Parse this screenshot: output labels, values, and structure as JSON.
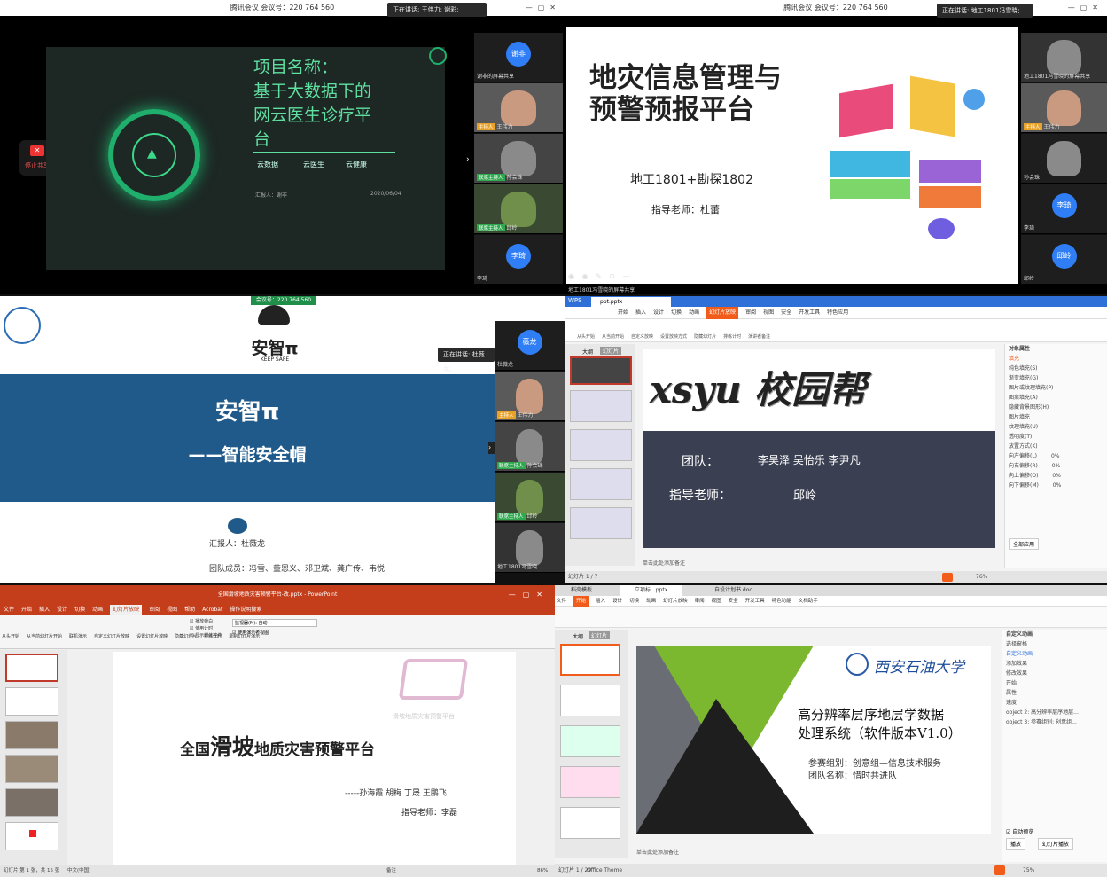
{
  "tile1": {
    "window_title": "腾讯会议 会议号：220 764 560",
    "speaking": "正在讲话: 王伟力; 谢彩;",
    "stop_share": "停止共享",
    "slide": {
      "title_lines": [
        "项目名称：",
        "基于大数据下的",
        "网云医生诊疗平",
        "台"
      ],
      "keywords": [
        "云数据",
        "云医生",
        "云健康"
      ],
      "reporter": "汇报人：谢非",
      "date": "2020/06/04"
    },
    "participants": [
      {
        "name": "谢非的屏幕共享",
        "avatar": "谢非"
      },
      {
        "name": "王伟力",
        "tag": "主持人"
      },
      {
        "name": "孙会珠",
        "tag": "联席主持人"
      },
      {
        "name": "邱岭",
        "tag": "联席主持人"
      },
      {
        "name": "李琦",
        "avatar": "李琦"
      }
    ]
  },
  "tile2": {
    "window_title": "腾讯会议 会议号：220 764 560",
    "speaking": "正在讲话: 地工1801冯雪晓;",
    "slide": {
      "title_lines": [
        "地灾信息管理与",
        "预警预报平台"
      ],
      "classes": "地工1801+勘探1802",
      "advisor": "指导老师：杜蕾"
    },
    "bottom_text": "地工1801冯雪晓的屏幕共享",
    "participants": [
      {
        "name": "地工1801冯雪晓的屏幕共享"
      },
      {
        "name": "王伟力",
        "tag": "主持人"
      },
      {
        "name": "孙会珠"
      },
      {
        "name": "李琦",
        "avatar": "李琦"
      },
      {
        "name": "邱岭",
        "avatar": "邱岭"
      }
    ]
  },
  "tile3": {
    "meeting_no": "会议号：220 764 560",
    "speaking": "正在讲话: 杜薇龙;",
    "slide": {
      "logo_title": "安智π",
      "logo_sub": "KEEP SAFE",
      "title": "安智π",
      "subtitle": "——智能安全帽",
      "reporter": "汇报人：杜薇龙",
      "members": "团队成员：冯雪、董恩义、邓卫斌、龚广传、韦悦"
    },
    "participants": [
      {
        "name": "杜薇龙",
        "avatar": "薇龙"
      },
      {
        "name": "王伟力",
        "tag": "主持人"
      },
      {
        "name": "孙会珠",
        "tag": "联席主持人"
      },
      {
        "name": "邱岭",
        "tag": "联席主持人"
      },
      {
        "name": "地工1801冯雪晓"
      }
    ]
  },
  "tile4": {
    "app": "WPS",
    "doc_tab": "ppt.pptx",
    "menu": [
      "开始",
      "插入",
      "设计",
      "切换",
      "动画",
      "幻灯片放映",
      "审阅",
      "视图",
      "安全",
      "开发工具",
      "特色应用"
    ],
    "active_menu": "幻灯片放映",
    "toolbar": [
      "从头开始",
      "从当前开始",
      "自定义放映",
      "设置放映方式",
      "隐藏幻灯片",
      "排练计时",
      "演讲者备注"
    ],
    "panel_tabs": [
      "大纲",
      "幻灯片"
    ],
    "slide": {
      "title": "xsyu 校园帮",
      "team_label": "团队：",
      "team": "李昊泽 吴怡乐 李尹凡",
      "advisor_label": "指导老师：",
      "advisor": "邱岭"
    },
    "notes": "单击此处添加备注",
    "status": "幻灯片 1 / 7",
    "zoom": "76%",
    "right_panel_title": "对象属性",
    "right_panel_rows": [
      "填充",
      "纯色填充(S)",
      "渐变填充(G)",
      "图片或纹理填充(P)",
      "图案填充(A)",
      "隐藏背景图形(H)",
      "图片填充",
      "纹理填充(U)",
      "透明度(T)",
      "放置方式(K)",
      "向左偏移(L)",
      "向右偏移(R)",
      "向上偏移(O)",
      "向下偏移(M)"
    ],
    "offsets": [
      "0%",
      "0%",
      "0%",
      "0%"
    ],
    "apply_all": "全部应用"
  },
  "tile5": {
    "window_title": "全国滑坡地质灾害预警平台-改.pptx - PowerPoint",
    "menu": [
      "文件",
      "开始",
      "插入",
      "设计",
      "切换",
      "动画",
      "幻灯片放映",
      "审阅",
      "视图",
      "帮助",
      "Acrobat",
      "操作说明搜索"
    ],
    "active_menu": "幻灯片放映",
    "ribbon": [
      "从头开始",
      "从当前幻灯片开始",
      "联机演示",
      "自定义幻灯片放映",
      "设置幻灯片放映",
      "隐藏幻灯片",
      "排练计时",
      "录制幻灯片演示"
    ],
    "checks": [
      "播放旁白",
      "使用计时",
      "显示媒体控件"
    ],
    "monitor": "监视器(M): 自动",
    "presenter_view": "使用演示者视图",
    "slide": {
      "logo_text": "滑坡地质灾害预警平台",
      "title_pre": "全国",
      "title_big": "滑坡",
      "title_post": "地质灾害预警平台",
      "authors": "-----孙海霞 胡梅 丁晟 王鹏飞",
      "advisor": "指导老师：李磊"
    },
    "status_left": "幻灯片 第 1 张，共 15 张",
    "status_lang": "中文(中国)",
    "notes_btn": "备注",
    "zoom": "86%"
  },
  "tile6": {
    "tabs": [
      "稻壳模板",
      "立项标...pptx",
      "自设计划书.doc"
    ],
    "menu": [
      "文件",
      "开始",
      "插入",
      "设计",
      "切换",
      "动画",
      "幻灯片放映",
      "审阅",
      "视图",
      "安全",
      "开发工具",
      "特色功能",
      "文档助手"
    ],
    "active_menu": "开始",
    "panel_tabs": [
      "大纲",
      "幻灯片"
    ],
    "slide": {
      "university": "西安石油大学",
      "title_line1": "高分辨率层序地层学数据",
      "title_line2": "处理系统（软件版本V1.0）",
      "group": "参赛组别：创意组—信息技术服务",
      "team": "团队名称：惜时共进队"
    },
    "notes": "单击此处添加备注",
    "status": "幻灯片 1 / 29",
    "theme": "Office Theme",
    "zoom": "75%",
    "right_panel_title": "自定义动画",
    "right_panel_items": [
      "选择窗格",
      "自定义动画",
      "添加效果",
      "修改效果",
      "开始",
      "属性",
      "速度"
    ],
    "anim_list": [
      "object 2: 高分辨率层序地层...",
      "object 3: 参赛组别: 创意组..."
    ],
    "auto_preview": "自动预览",
    "play_btn": "播放",
    "slideshow_btn": "幻灯片播放"
  }
}
